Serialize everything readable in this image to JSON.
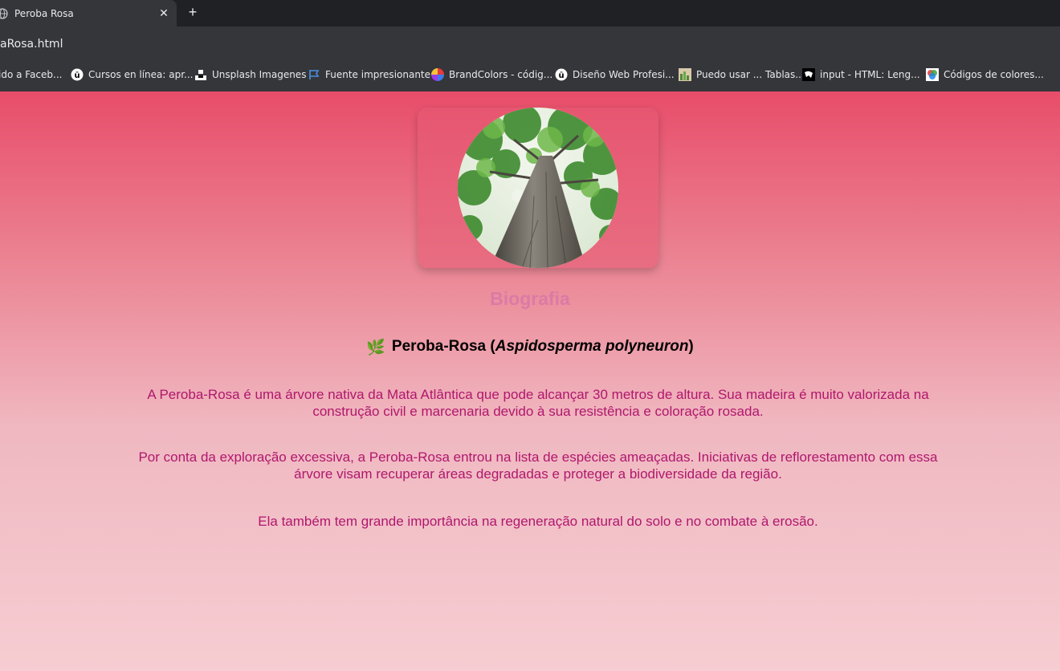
{
  "browser": {
    "tab_title": "Peroba Rosa",
    "tab_close": "✕",
    "new_tab": "+",
    "url": "aRosa.html",
    "bookmarks": [
      {
        "label": "ido a Faceb...",
        "icon": "none"
      },
      {
        "label": "Cursos en línea: apr...",
        "icon": "udemy-icon"
      },
      {
        "label": "Unsplash Imagenes",
        "icon": "unsplash-icon"
      },
      {
        "label": "Fuente impresionante",
        "icon": "flag-icon"
      },
      {
        "label": "BrandColors - códig...",
        "icon": "color-wheel-icon"
      },
      {
        "label": "Diseño Web Profesi...",
        "icon": "udemy-icon"
      },
      {
        "label": "Puedo usar ... Tablas...",
        "icon": "caniuse-icon"
      },
      {
        "label": "input - HTML: Leng...",
        "icon": "mdn-icon"
      },
      {
        "label": "Códigos de colores...",
        "icon": "rgb-icon"
      }
    ]
  },
  "page": {
    "heading": "Biografia",
    "species": {
      "emoji": "🌿",
      "name": "Peroba-Rosa",
      "open": " (",
      "scientific": "Aspidosperma polyneuron",
      "close": ")"
    },
    "paragraphs": [
      "A Peroba-Rosa é uma árvore nativa da Mata Atlântica que pode alcançar 30 metros de altura. Sua madeira é muito valorizada na construção civil e marcenaria devido à sua resistência e coloração rosada.",
      "Por conta da exploração excessiva, a Peroba-Rosa entrou na lista de espécies ameaçadas. Iniciativas de reflorestamento com essa árvore visam recuperar áreas degradadas e proteger a biodiversidade da região.",
      "Ela também tem grande importância na regeneração natural do solo e no combate à erosão."
    ],
    "colors": {
      "gradient_top": "#e84d69",
      "gradient_bottom": "#f6cdd2",
      "heading": "#dc7aa6",
      "paragraph": "#b0176d"
    }
  }
}
